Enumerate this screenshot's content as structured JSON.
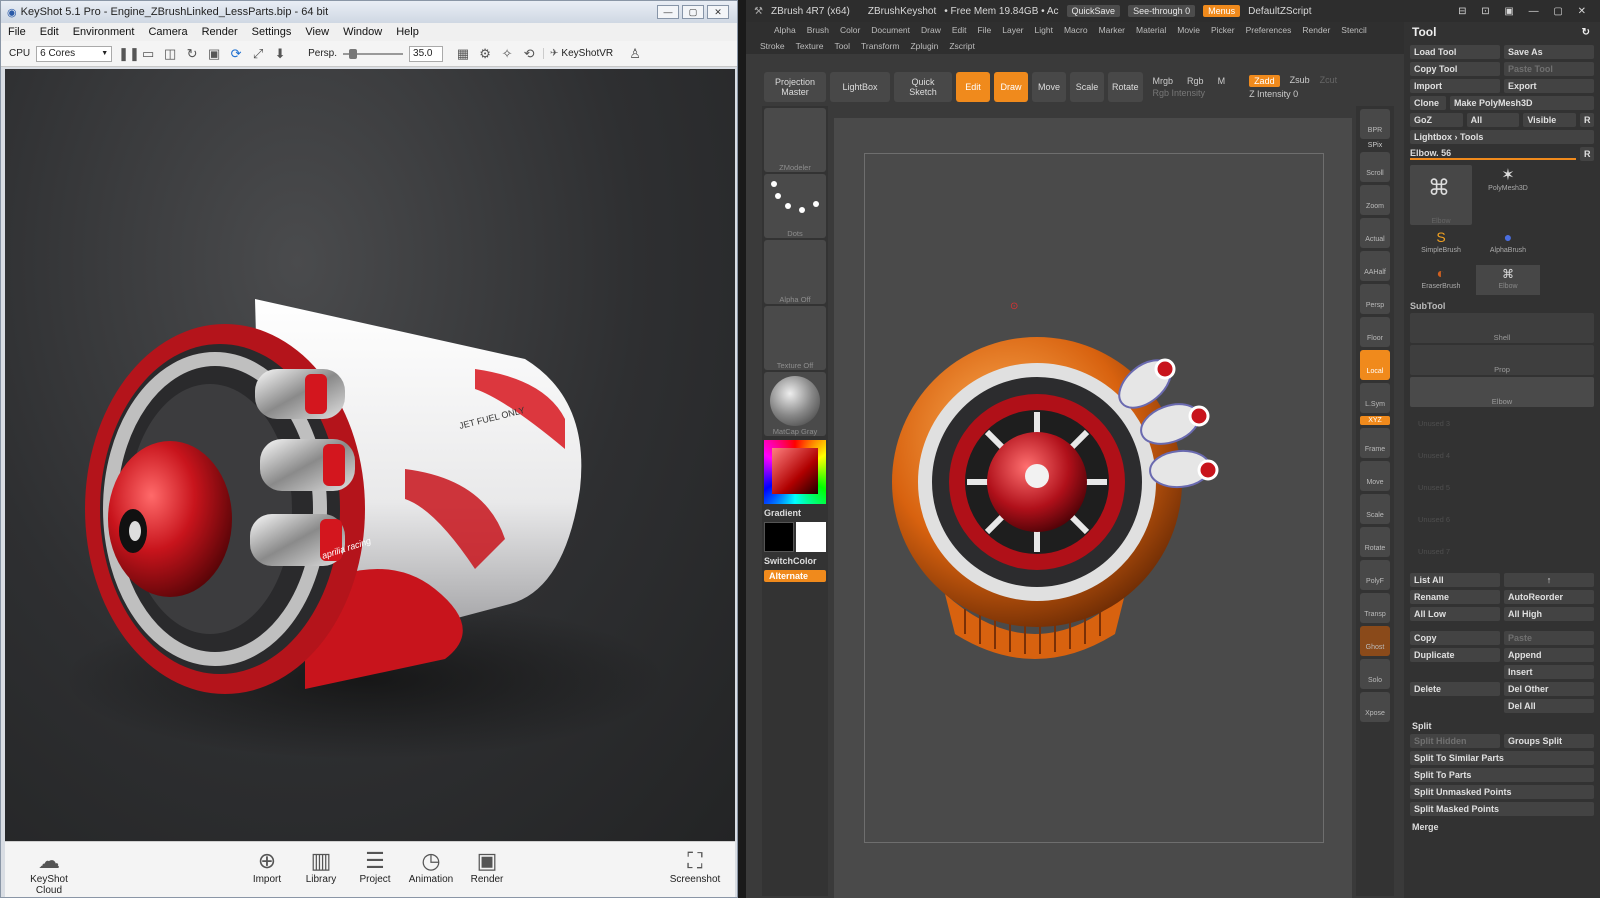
{
  "keyshot": {
    "title": "KeyShot 5.1 Pro - Engine_ZBrushLinked_LessParts.bip - 64 bit",
    "menu": [
      "File",
      "Edit",
      "Environment",
      "Camera",
      "Render",
      "Settings",
      "View",
      "Window",
      "Help"
    ],
    "toolbar": {
      "cpu_label": "CPU",
      "cores": "6 Cores",
      "persp_label": "Persp.",
      "persp_value": "35.0",
      "vr_label": "KeyShotVR"
    },
    "render_text": {
      "fuel": "JET FUEL ONLY",
      "brand": "aprilia racing"
    },
    "bottom": [
      "KeyShot Cloud",
      "Import",
      "Library",
      "Project",
      "Animation",
      "Render",
      "Screenshot"
    ]
  },
  "zbrush": {
    "title": "ZBrush 4R7 (x64)",
    "doc": "ZBrushKeyshot",
    "mem": "• Free Mem 19.84GB • Ac",
    "quicksave": "QuickSave",
    "seethrough": "See-through  0",
    "menus_btn": "Menus",
    "script": "DefaultZScript",
    "menu1": [
      "Alpha",
      "Brush",
      "Color",
      "Document",
      "Draw",
      "Edit",
      "File",
      "Layer",
      "Light",
      "Macro",
      "Marker",
      "Material",
      "Movie",
      "Picker",
      "Preferences",
      "Render",
      "Stencil"
    ],
    "menu2": [
      "Stroke",
      "Texture",
      "Tool",
      "Transform",
      "Zplugin",
      "Zscript"
    ],
    "shelf": {
      "projection": "Projection Master",
      "lightbox": "LightBox",
      "quicksketch": "Quick Sketch",
      "edit": "Edit",
      "draw": "Draw",
      "move": "Move",
      "scale": "Scale",
      "rotate": "Rotate",
      "mrgb": "Mrgb",
      "rgb": "Rgb",
      "m": "M",
      "zadd": "Zadd",
      "zsub": "Zsub",
      "zcut": "Zcut",
      "rgb_int": "Rgb Intensity",
      "z_int": "Z Intensity 0"
    },
    "left": {
      "zmodeler": "ZModeler",
      "dots": "Dots",
      "alpha": "Alpha Off",
      "texture": "Texture Off",
      "matcap": "MatCap Gray",
      "gradient": "Gradient",
      "switchcolor": "SwitchColor",
      "alternate": "Alternate"
    },
    "right": [
      "BPR",
      "SPix",
      "Scroll",
      "Zoom",
      "Actual",
      "AAHalf",
      "Persp",
      "Floor",
      "Local",
      "L.Sym",
      "XYZ",
      "Frame",
      "Move",
      "Scale",
      "Rotate",
      "PolyF",
      "Transp",
      "Ghost",
      "Solo",
      "Xpose"
    ],
    "tool": {
      "header": "Tool",
      "row1": [
        "Load Tool",
        "Save As"
      ],
      "row2": [
        "Copy Tool",
        "Paste Tool"
      ],
      "row3": [
        "Import",
        "Export"
      ],
      "row4": [
        "Clone",
        "Make PolyMesh3D"
      ],
      "row5": [
        "GoZ",
        "All",
        "Visible",
        "R"
      ],
      "lightbox": "Lightbox › Tools",
      "elbow": "Elbow. 56",
      "tools": [
        "Elbow",
        "PolyMesh3D",
        "SimpleBrush",
        "AlphaBrush",
        "EraserBrush",
        "Elbow"
      ],
      "subtool": "SubTool",
      "subs": [
        "Shell",
        "Prop",
        "Elbow"
      ],
      "unused": [
        "Unused 3",
        "Unused 4",
        "Unused 5",
        "Unused 6",
        "Unused 7"
      ],
      "listall": "List All",
      "rename": "Rename",
      "autoreorder": "AutoReorder",
      "alllow": "All Low",
      "allhigh": "All High",
      "copy": "Copy",
      "paste": "Paste",
      "append": "Append",
      "duplicate": "Duplicate",
      "insert": "Insert",
      "delete": "Delete",
      "delother": "Del Other",
      "delall": "Del All",
      "split": "Split",
      "splithidden": "Split Hidden",
      "groupssplit": "Groups Split",
      "split_list": [
        "Split To Similar Parts",
        "Split To Parts",
        "Split Unmasked Points",
        "Split Masked Points"
      ],
      "merge": "Merge"
    }
  }
}
